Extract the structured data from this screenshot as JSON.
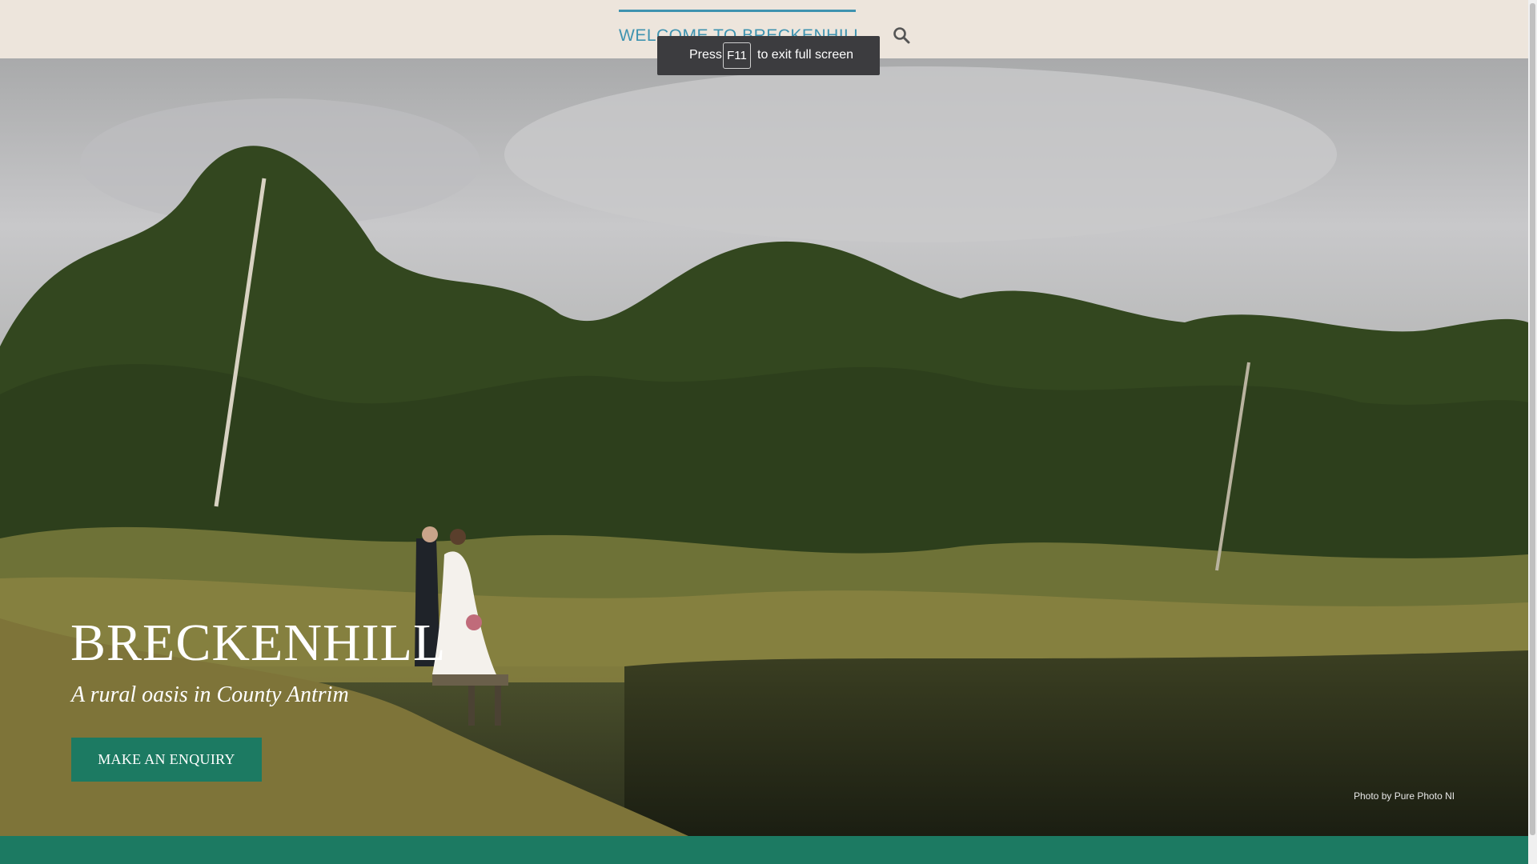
{
  "nav": {
    "item_label": "WELCOME TO BRECKENHILL",
    "search_icon": "search-icon",
    "chevron_icon": "chevron-down-icon"
  },
  "toast": {
    "press": "Press",
    "key": "F11",
    "rest": "to exit full screen"
  },
  "hero": {
    "title": "BRECKENHILL",
    "subtitle": "A rural oasis in County Antrim",
    "cta_label": "MAKE AN ENQUIRY",
    "photo_credit": "Photo by Pure Photo NI"
  },
  "colors": {
    "background": "#ede5dc",
    "accent_blue": "#3f93b0",
    "brand_green": "#1c7a62"
  }
}
